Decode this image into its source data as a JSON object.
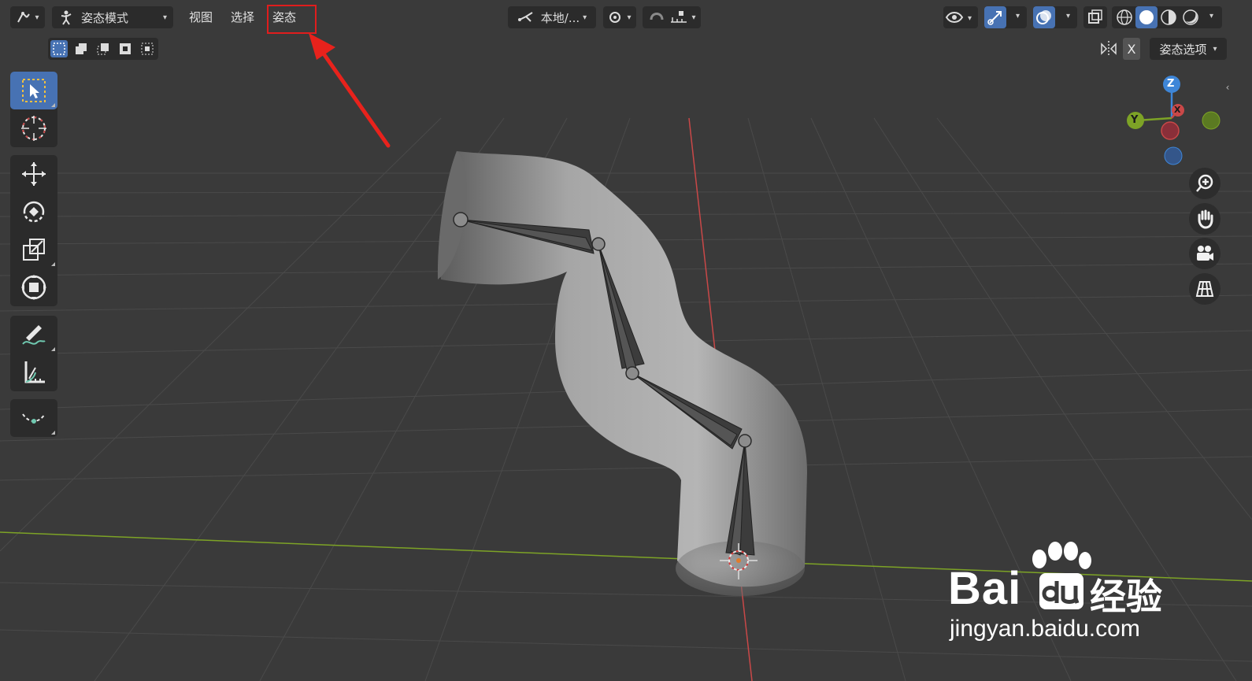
{
  "header": {
    "mode_label": "姿态模式",
    "menu": [
      "视图",
      "选择",
      "姿态"
    ],
    "transform_orientation": "本地/...",
    "pose_options": "姿态选项",
    "mirror_axis": "X"
  },
  "gizmo": {
    "z": "Z",
    "y": "Y",
    "x": "X"
  },
  "watermark": {
    "brand": "Bai",
    "brand_suffix": "经验",
    "url": "jingyan.baidu.com"
  },
  "colors": {
    "accent": "#4772b3",
    "highlight": "#e01d1d",
    "arrow": "#e8221c",
    "axis_x": "#c94848",
    "axis_y": "#7da326",
    "axis_z": "#3e86d8"
  },
  "icons": {
    "editor_type": "armature-editor-icon",
    "select_box": "select-box-icon",
    "cursor": "cursor-icon",
    "move": "move-icon",
    "rotate": "rotate-icon",
    "scale": "scale-icon",
    "transform": "transform-icon",
    "annotate": "annotate-icon",
    "measure": "measure-icon",
    "relax": "relax-icon",
    "zoom": "zoom-icon",
    "pan": "hand-icon",
    "camera": "camera-icon",
    "perspective": "grid-icon"
  }
}
